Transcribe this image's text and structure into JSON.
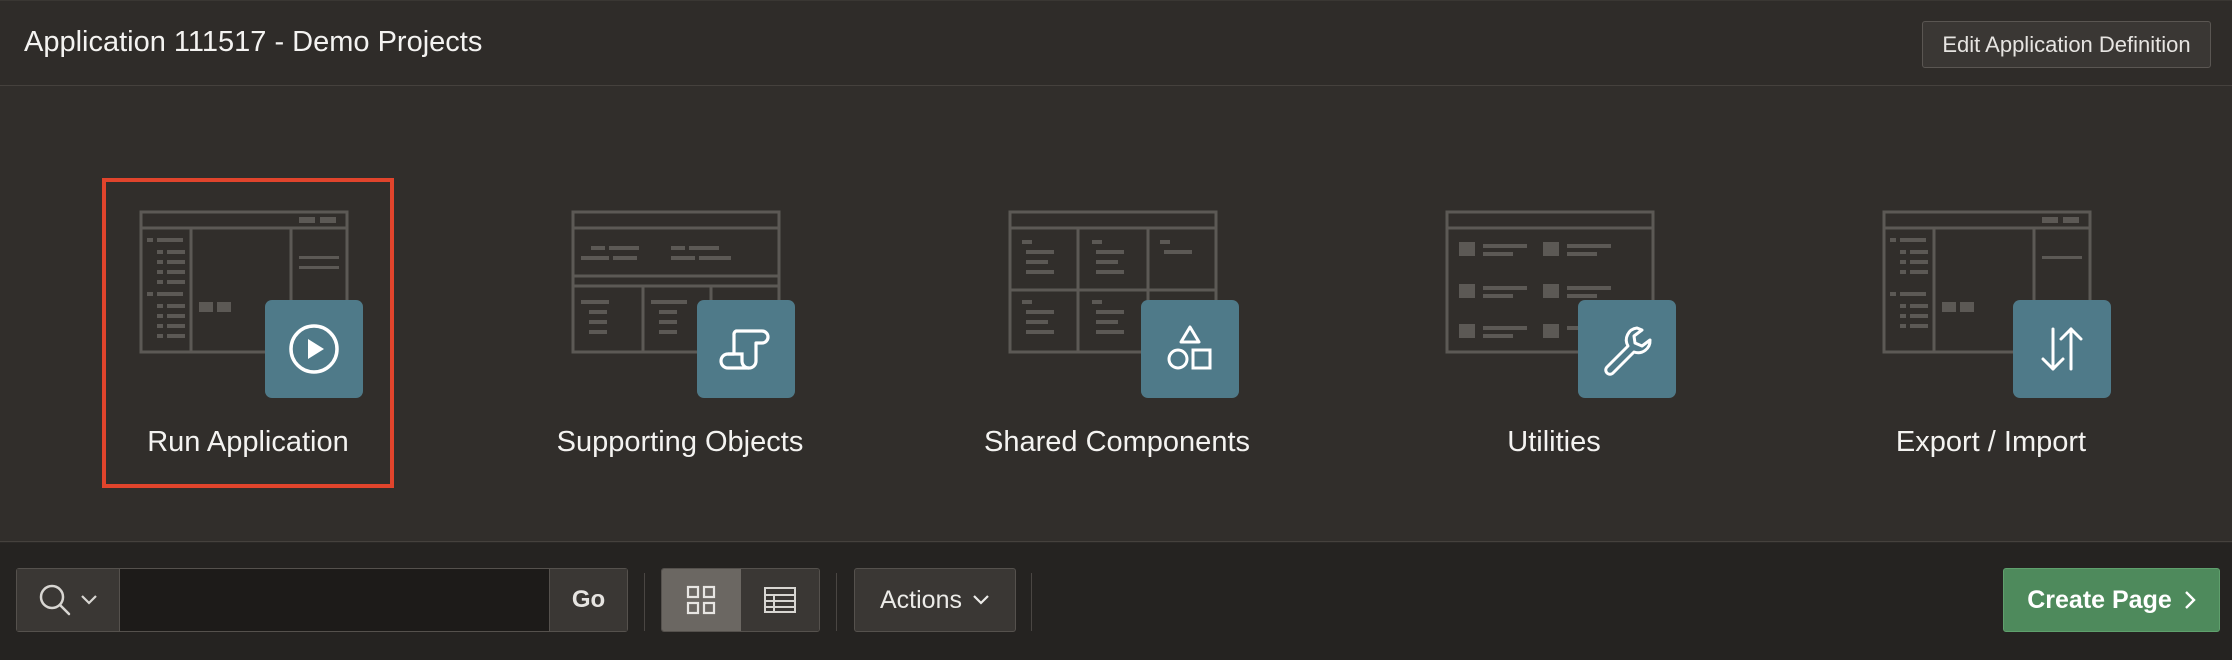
{
  "header": {
    "title": "Application 111517 - Demo Projects",
    "edit_button": "Edit Application Definition"
  },
  "tiles": [
    {
      "label": "Run Application",
      "icon": "play-icon",
      "selected": true
    },
    {
      "label": "Supporting Objects",
      "icon": "scroll-icon",
      "selected": false
    },
    {
      "label": "Shared Components",
      "icon": "shapes-icon",
      "selected": false
    },
    {
      "label": "Utilities",
      "icon": "wrench-icon",
      "selected": false
    },
    {
      "label": "Export / Import",
      "icon": "arrows-up-down-icon",
      "selected": false
    }
  ],
  "toolbar": {
    "search_value": "",
    "search_placeholder": "",
    "go_label": "Go",
    "actions_label": "Actions",
    "create_label": "Create Page",
    "view_mode": "icons"
  },
  "colors": {
    "accent_selected": "#e0442c",
    "badge": "#4f7a89",
    "create_button": "#4e8a5c"
  }
}
